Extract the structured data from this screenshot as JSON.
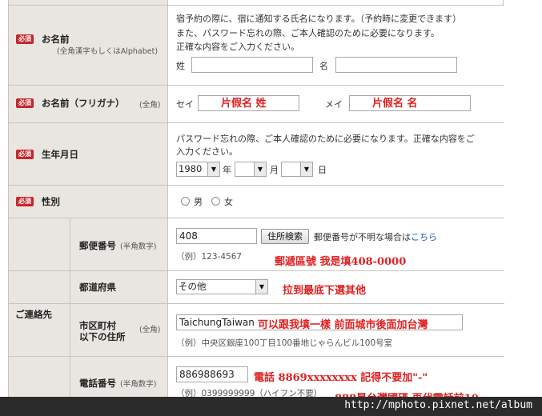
{
  "name_row": {
    "label": "お名前",
    "sublabel": "(全角漢字もしくはAlphabet)",
    "required": "必須",
    "notes": [
      "宿予約の際に、宿に通知する氏名になります。（予約時に変更できます）",
      "また、パスワード忘れの際、ご本人確認のために必要になります。",
      "正確な内容をご入力ください。"
    ],
    "sei_label": "姓",
    "mei_label": "名",
    "sei_value": "",
    "mei_value": ""
  },
  "kana_row": {
    "label": "お名前（フリガナ）",
    "sublabel": "(全角)",
    "required": "必須",
    "sei_label": "セイ",
    "mei_label": "メイ",
    "sei_annotation": "片假名 姓",
    "mei_annotation": "片假名 名"
  },
  "birth_row": {
    "label": "生年月日",
    "required": "必須",
    "notes": [
      "パスワード忘れの際、ご本人確認のために必要になります。正確な内容をご",
      "入力ください。"
    ],
    "year_value": "1980",
    "year_unit": "年",
    "month_value": "",
    "month_unit": "月",
    "day_value": "",
    "day_unit": "日"
  },
  "gender_row": {
    "label": "性別",
    "required": "必須",
    "male": "男",
    "female": "女"
  },
  "contact": {
    "group_label": "ご連絡先",
    "postal": {
      "label": "郵便番号",
      "sublabel": "(半角数字)",
      "value": "408",
      "search_button": "住所検索",
      "unknown_text": "郵便番号が不明な場合は",
      "link_text": "こちら",
      "example": "（例）123-4567",
      "annotation": "郵遞區號 我是填408-0000"
    },
    "prefecture": {
      "label": "都道府県",
      "value": "その他",
      "annotation": "拉到最底下選其他"
    },
    "city": {
      "label_line1": "市区町村",
      "label_line2": "以下の住所",
      "sublabel": "(全角)",
      "value": "TaichungTaiwan",
      "annotation": "可以跟我填一樣 前面城市後面加台灣",
      "example": "（例）中央区銀座100丁目100番地じゃらんビル100号室"
    },
    "phone": {
      "label": "電話番号",
      "sublabel": "(半角数字)",
      "value": "886988693",
      "annotation": "電話 8869xxxxxxxx 記得不要加\"-\"",
      "example": "（例）0399999999（ハイフン不要）",
      "annotation2": "888是台灣國碼 再代電話前10"
    }
  },
  "watermark": "http://mphoto.pixnet.net/album",
  "colors": {
    "required_badge": "#c8252c",
    "annotation": "#e02020",
    "label_bg": "#e9e6e1",
    "link": "#1a5fb4"
  }
}
